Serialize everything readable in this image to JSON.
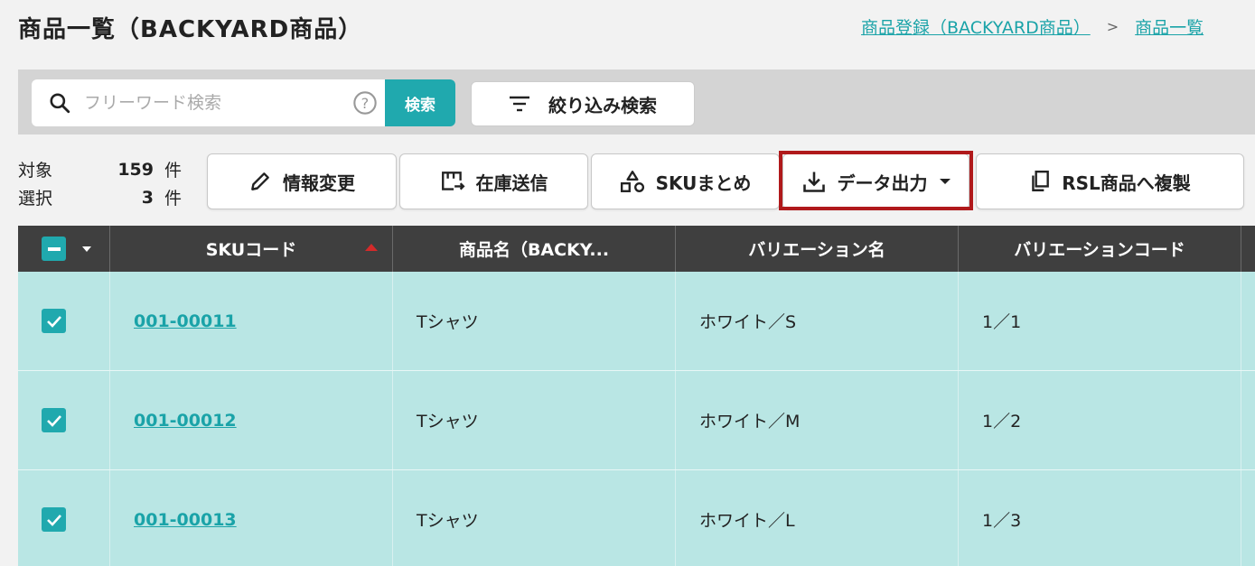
{
  "header": {
    "title": "商品一覧（BACKYARD商品）",
    "breadcrumb": [
      "商品登録（BACKYARD商品）",
      "商品一覧"
    ]
  },
  "search": {
    "placeholder": "フリーワード検索",
    "search_label": "検索",
    "filter_label": "絞り込み検索"
  },
  "counts": {
    "target_label": "対象",
    "target_count": "159",
    "target_unit": "件",
    "selected_label": "選択",
    "selected_count": "3",
    "selected_unit": "件"
  },
  "actions": {
    "edit": "情報変更",
    "stock": "在庫送信",
    "sku_merge": "SKUまとめ",
    "export": "データ出力",
    "copy_rsl": "RSL商品へ複製"
  },
  "table": {
    "columns": [
      "SKUコード",
      "商品名（BACKY...",
      "バリエーション名",
      "バリエーションコード"
    ],
    "rows": [
      {
        "sku": "001-00011",
        "name": "Tシャツ",
        "variation": "ホワイト／S",
        "code": "1／1"
      },
      {
        "sku": "001-00012",
        "name": "Tシャツ",
        "variation": "ホワイト／M",
        "code": "1／2"
      },
      {
        "sku": "001-00013",
        "name": "Tシャツ",
        "variation": "ホワイト／L",
        "code": "1／3"
      }
    ]
  },
  "colors": {
    "accent": "#20a9ae",
    "highlight": "#b0191b",
    "row_selected": "#b9e6e4",
    "header_bg": "#3f3f3f"
  }
}
